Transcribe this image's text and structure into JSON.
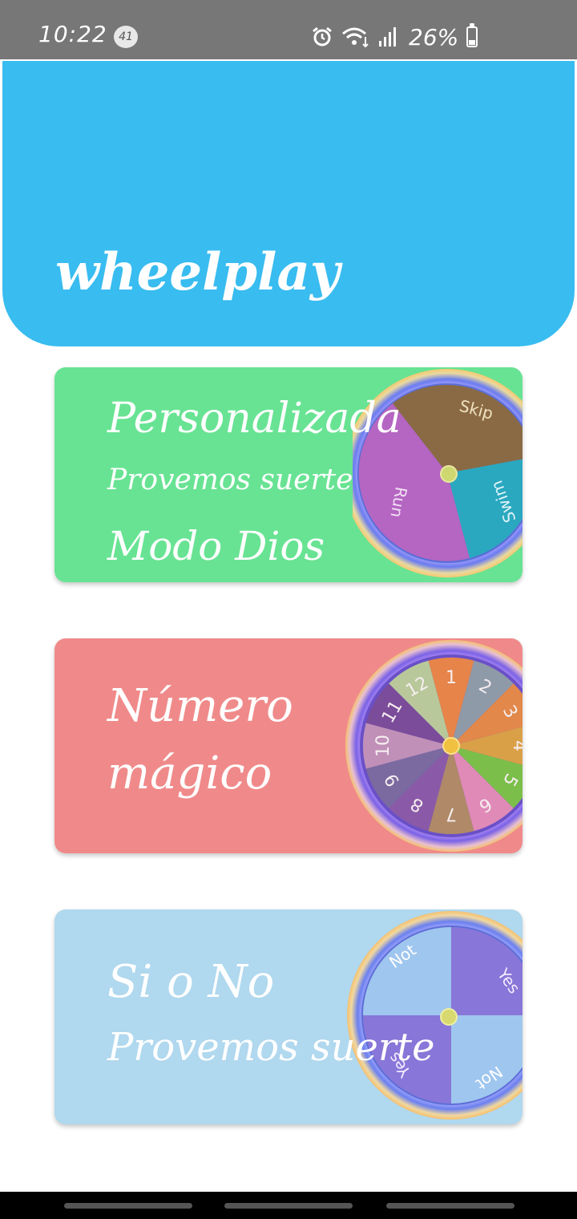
{
  "status_bar": {
    "time": "10:22",
    "notification_badge": "41",
    "battery": "26%",
    "battery_level": 0.26,
    "icons": [
      "alarm-icon",
      "wifi-icon",
      "cellular-signal-icon",
      "battery-icon"
    ]
  },
  "header": {
    "title": "wheelplay",
    "color": "#39bcf0"
  },
  "cards": [
    {
      "title": "Personalizada",
      "subtitle": "Provemos suerte",
      "footer": "Modo Dios",
      "color": "#68e393",
      "wheel_labels": [
        "Skip",
        "Swim",
        "Run"
      ]
    },
    {
      "title_line1": "Número",
      "title_line2": "mágico",
      "color": "#f08a8a",
      "wheel_numbers": [
        "1",
        "2",
        "3",
        "4",
        "5",
        "6",
        "7",
        "8",
        "9",
        "10",
        "11",
        "12"
      ]
    },
    {
      "title": "Si o No",
      "subtitle": "Provemos suerte",
      "color": "#b0d8ee",
      "wheel_labels": [
        "Yes",
        "Not",
        "Yes",
        "Not"
      ]
    }
  ]
}
